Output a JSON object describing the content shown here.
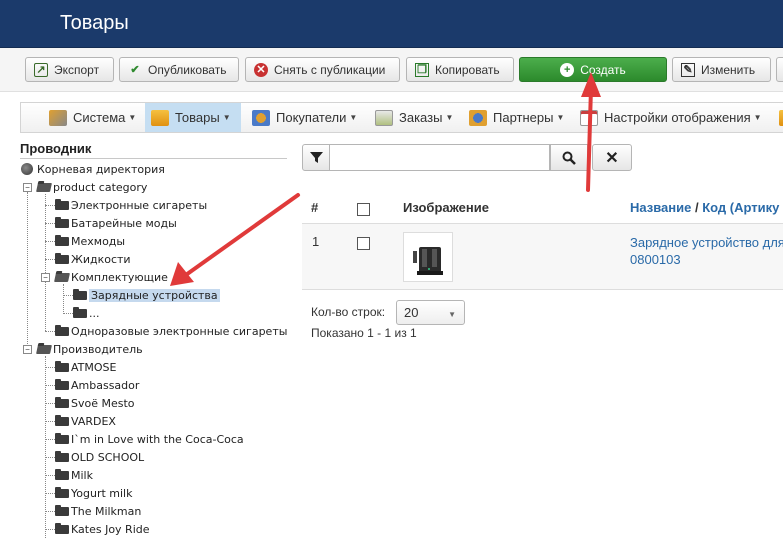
{
  "header": {
    "title": "Товары"
  },
  "toolbar": {
    "export_label": "Экспорт",
    "publish_label": "Опубликовать",
    "unpublish_label": "Снять с публикации",
    "copy_label": "Копировать",
    "create_label": "Создать",
    "edit_label": "Изменить"
  },
  "menu": {
    "items": [
      {
        "label": "Система",
        "icon": "wrench-icon"
      },
      {
        "label": "Товары",
        "icon": "box-icon"
      },
      {
        "label": "Покупатели",
        "icon": "users-icon"
      },
      {
        "label": "Заказы",
        "icon": "orders-icon"
      },
      {
        "label": "Партнеры",
        "icon": "partners-icon"
      },
      {
        "label": "Настройки отображения",
        "icon": "settings-icon"
      }
    ]
  },
  "tree": {
    "title": "Проводник",
    "root": "Корневая директория",
    "product_category": "product category",
    "categories": [
      "Электронные сигареты",
      "Батарейные моды",
      "Мехмоды",
      "Жидкости",
      "Комплектующие",
      "Зарядные устройства",
      "...",
      "Одноразовые электронные сигареты"
    ],
    "manufacturer": "Производитель",
    "manufacturers": [
      "ATMOSE",
      "Ambassador",
      "Svoё Mesto",
      "VARDEX",
      "I`m in Love with the Coca-Coca",
      "OLD SCHOOL",
      "Milk",
      "Yogurt milk",
      "The Milkman",
      "Kates Joy Ride"
    ]
  },
  "search": {
    "value": "",
    "placeholder": ""
  },
  "table": {
    "headers": {
      "num": "#",
      "image": "Изображение",
      "name": "Название",
      "sep": " / ",
      "code": "Код (Артику"
    },
    "rows": [
      {
        "num": "1",
        "name": "Зарядное устройство для",
        "code": "0800103"
      }
    ]
  },
  "pagination": {
    "rows_label": "Кол-во строк:",
    "rows_value": "20",
    "shown": "Показано 1 - 1 из 1"
  },
  "colors": {
    "header_bg": "#1b3a6b",
    "create_green": "#3a9a3a",
    "arrow_red": "#e03a3a",
    "link_blue": "#2a6aa8"
  }
}
